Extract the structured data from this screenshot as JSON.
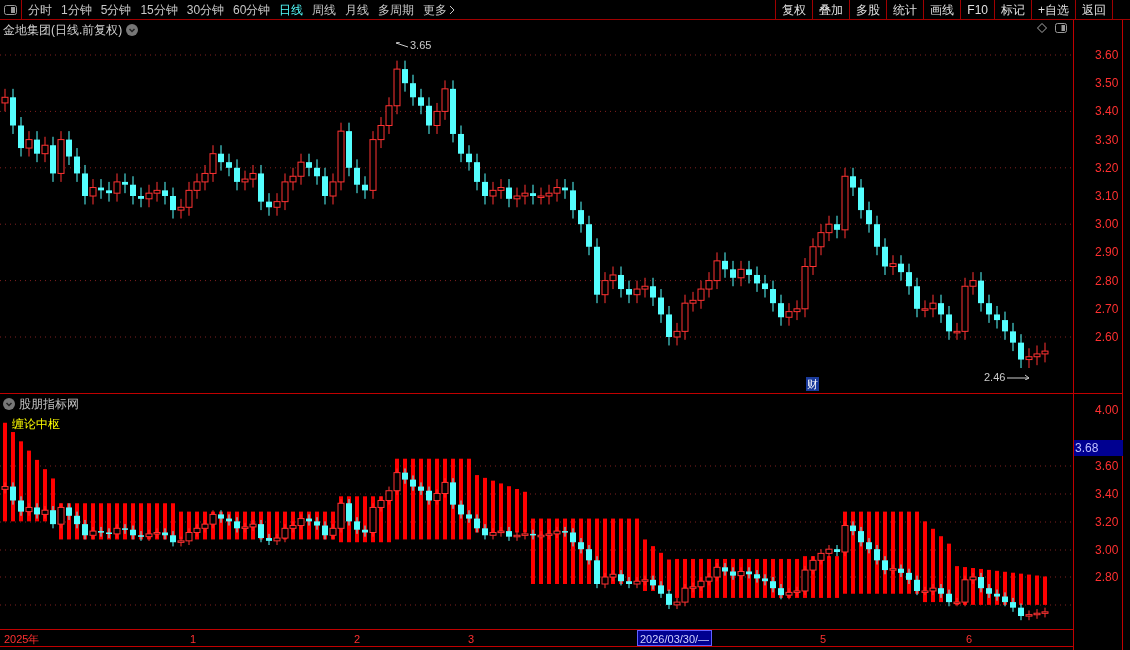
{
  "toolbar": {
    "periods": [
      {
        "label": "分时",
        "selected": false
      },
      {
        "label": "1分钟",
        "selected": false
      },
      {
        "label": "5分钟",
        "selected": false
      },
      {
        "label": "15分钟",
        "selected": false
      },
      {
        "label": "30分钟",
        "selected": false
      },
      {
        "label": "60分钟",
        "selected": false
      },
      {
        "label": "日线",
        "selected": true
      },
      {
        "label": "周线",
        "selected": false
      },
      {
        "label": "月线",
        "selected": false
      },
      {
        "label": "多周期",
        "selected": false
      },
      {
        "label": "更多",
        "selected": false
      }
    ],
    "buttons": [
      "复权",
      "叠加",
      "多股",
      "统计",
      "画线",
      "F10",
      "标记",
      "+自选",
      "返回"
    ]
  },
  "main_chart": {
    "title": "金地集团(日线.前复权)",
    "high_label": "3.65",
    "low_label": "2.46",
    "event_marker": "财",
    "y_ticks": [
      "3.60",
      "3.50",
      "3.40",
      "3.30",
      "3.20",
      "3.10",
      "3.00",
      "2.90",
      "2.80",
      "2.70",
      "2.60"
    ]
  },
  "indicator_panel": {
    "title": "股朋指标网",
    "legend": "缠论中枢",
    "y_ticks": [
      "4.00",
      "3.60",
      "3.40",
      "3.20",
      "3.00",
      "2.80"
    ],
    "cursor_price": "3.68"
  },
  "date_axis": {
    "labels": [
      "2025年",
      "1",
      "2",
      "3",
      "5",
      "6"
    ],
    "cursor_date": "2026/03/30/—"
  }
}
